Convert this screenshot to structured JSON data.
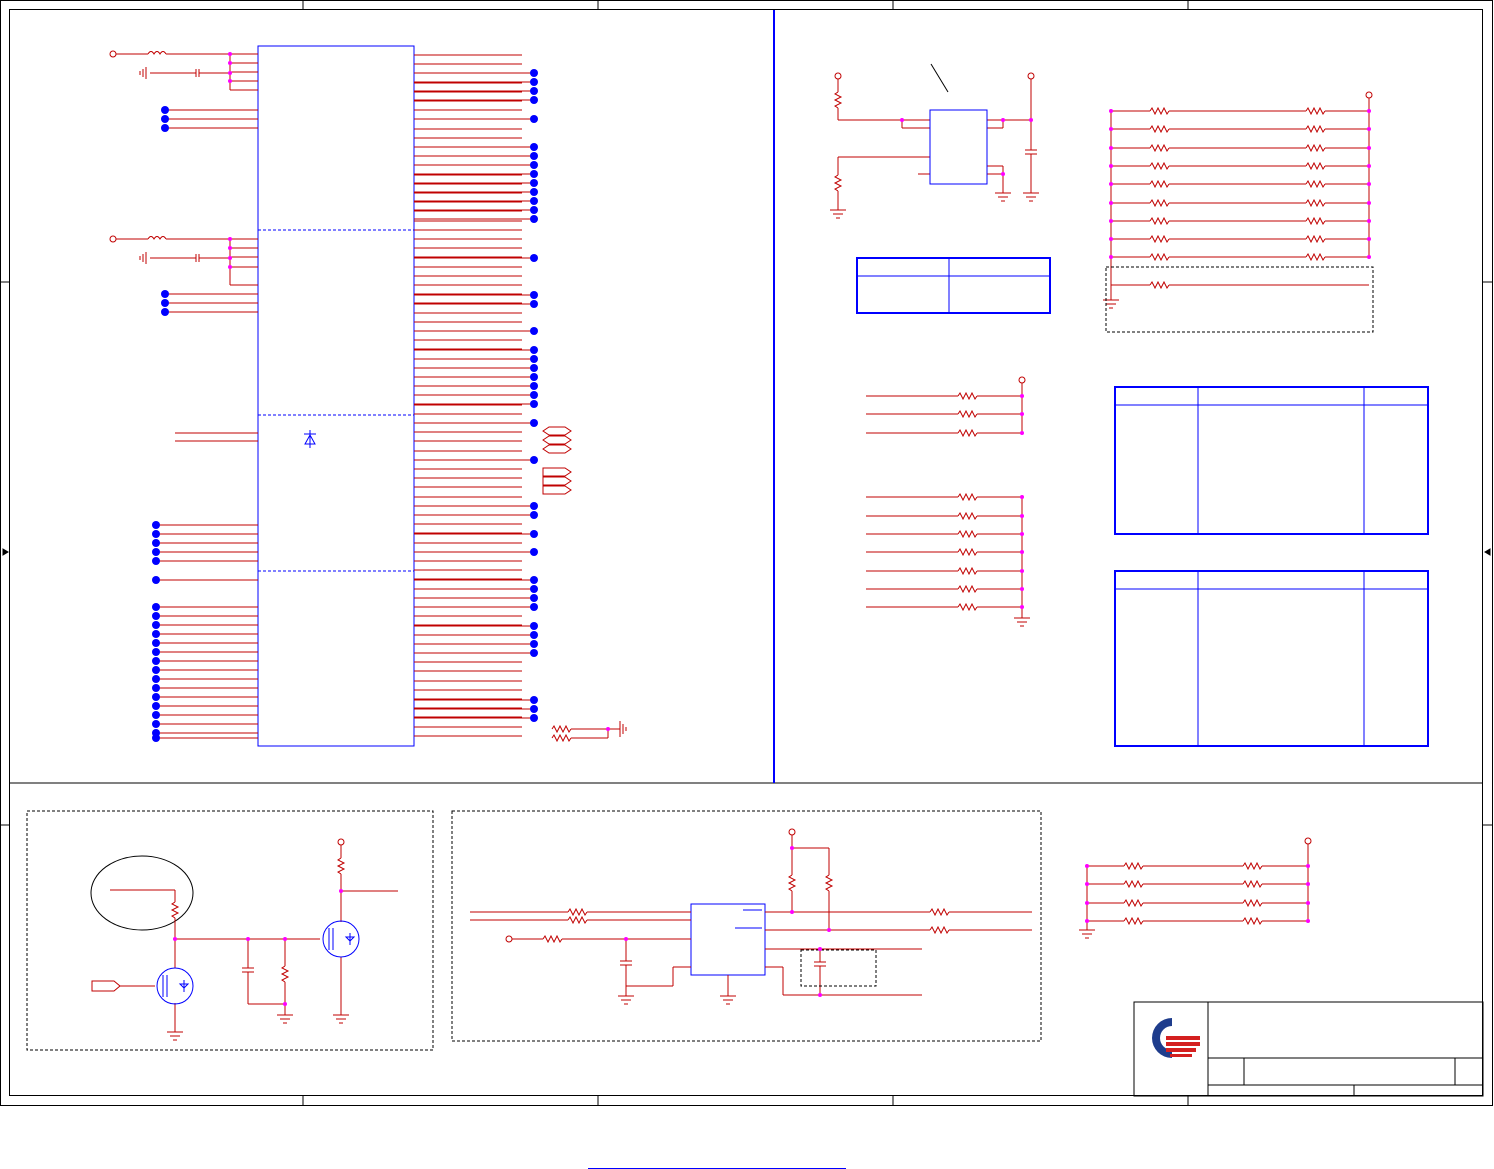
{
  "page": {
    "title": "",
    "footer_link": ""
  },
  "colors": {
    "frame": "#000000",
    "ic_outline": "#0000ff",
    "net_wire": "#c00000",
    "junction": "#ff00ff",
    "net_dot": "#0000ff",
    "divider": "#0000ff",
    "logo_blue": "#1e3c8c",
    "logo_red": "#d42020"
  },
  "title_block": {
    "logo": "company-logo-icon",
    "rows": [
      "",
      "",
      ""
    ]
  },
  "sections": [
    "ic-pinout",
    "reset-circuit",
    "pullup-resistor-array",
    "config-table",
    "strap-resistors",
    "pin-table-1",
    "pin-table-2",
    "mosfet-power-switch",
    "regulator-circuit",
    "bottom-resistor-array"
  ]
}
